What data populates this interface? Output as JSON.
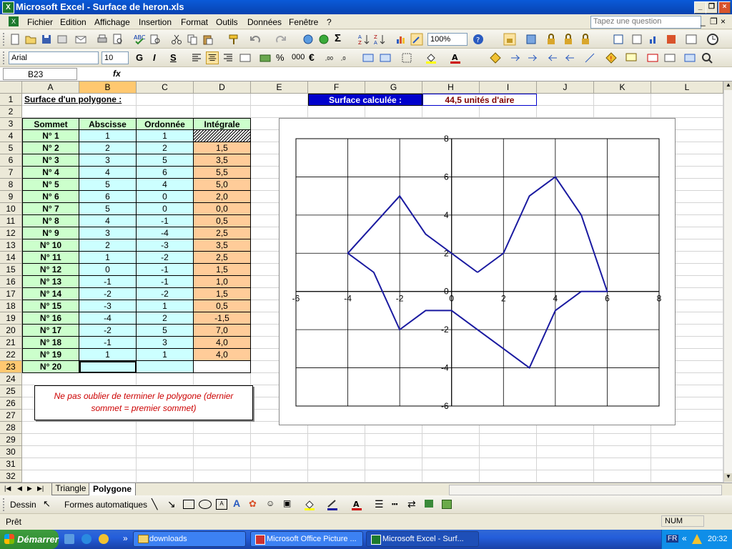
{
  "window": {
    "title": "Microsoft Excel - Surface de heron.xls",
    "app_icon": "excel-icon"
  },
  "menu": {
    "items": [
      "Fichier",
      "Edition",
      "Affichage",
      "Insertion",
      "Format",
      "Outils",
      "Données",
      "Fenêtre",
      "?"
    ],
    "ask_placeholder": "Tapez une question"
  },
  "toolbar": {
    "zoom": "100%",
    "font": "Arial",
    "size": "10",
    "bold": "G",
    "italic": "I",
    "underline": "S",
    "percent": "%",
    "thousands": "000",
    "euro": "€"
  },
  "formula_bar": {
    "name_box": "B23",
    "fx": "fx",
    "content": ""
  },
  "columns": [
    "A",
    "B",
    "C",
    "D",
    "E",
    "F",
    "G",
    "H",
    "I",
    "J",
    "K",
    "L"
  ],
  "rows": [
    "1",
    "2",
    "3",
    "4",
    "5",
    "6",
    "7",
    "8",
    "9",
    "10",
    "11",
    "12",
    "13",
    "14",
    "15",
    "16",
    "17",
    "18",
    "19",
    "20",
    "21",
    "22",
    "23",
    "24",
    "25",
    "26",
    "27",
    "28",
    "29",
    "30",
    "31",
    "32"
  ],
  "sheet": {
    "title": "Surface d'un polygone :",
    "surface_label": "Surface calculée :",
    "surface_value": "44,5 unités d'aire",
    "headers": [
      "Sommet",
      "Abscisse",
      "Ordonnée",
      "Intégrale"
    ],
    "table": [
      [
        "N° 1",
        "1",
        "1",
        ""
      ],
      [
        "N° 2",
        "2",
        "2",
        "1,5"
      ],
      [
        "N° 3",
        "3",
        "5",
        "3,5"
      ],
      [
        "N° 4",
        "4",
        "6",
        "5,5"
      ],
      [
        "N° 5",
        "5",
        "4",
        "5,0"
      ],
      [
        "N° 6",
        "6",
        "0",
        "2,0"
      ],
      [
        "N° 7",
        "5",
        "0",
        "0,0"
      ],
      [
        "N° 8",
        "4",
        "-1",
        "0,5"
      ],
      [
        "N° 9",
        "3",
        "-4",
        "2,5"
      ],
      [
        "N° 10",
        "2",
        "-3",
        "3,5"
      ],
      [
        "N° 11",
        "1",
        "-2",
        "2,5"
      ],
      [
        "N° 12",
        "0",
        "-1",
        "1,5"
      ],
      [
        "N° 13",
        "-1",
        "-1",
        "1,0"
      ],
      [
        "N° 14",
        "-2",
        "-2",
        "1,5"
      ],
      [
        "N° 15",
        "-3",
        "1",
        "0,5"
      ],
      [
        "N° 16",
        "-4",
        "2",
        "-1,5"
      ],
      [
        "N° 17",
        "-2",
        "5",
        "7,0"
      ],
      [
        "N° 18",
        "-1",
        "3",
        "4,0"
      ],
      [
        "N° 19",
        "1",
        "1",
        "4,0"
      ],
      [
        "N° 20",
        "",
        "",
        ""
      ]
    ],
    "note": "Ne pas oublier de terminer le polygone (dernier sommet = premier sommet)",
    "colors": {
      "header": "#ccffcc",
      "sommet": "#ccffcc",
      "coords": "#ccffff",
      "integral": "#ffcc99",
      "surface_label_bg": "#0000cc",
      "surface_value": "#800000",
      "note": "#cc0000"
    }
  },
  "chart_data": {
    "type": "scatter",
    "x": [
      1,
      2,
      3,
      4,
      5,
      6,
      5,
      4,
      3,
      2,
      1,
      0,
      -1,
      -2,
      -3,
      -4,
      -2,
      -1,
      1
    ],
    "y": [
      1,
      2,
      5,
      6,
      4,
      0,
      0,
      -1,
      -4,
      -3,
      -2,
      -1,
      -1,
      -2,
      1,
      2,
      5,
      3,
      1
    ],
    "xlim": [
      -6,
      8
    ],
    "ylim": [
      -6,
      8
    ],
    "xticks": [
      "-6",
      "-4",
      "-2",
      "0",
      "2",
      "4",
      "6",
      "8"
    ],
    "yticks": [
      "-6",
      "-4",
      "-2",
      "0",
      "2",
      "4",
      "6",
      "8"
    ],
    "grid": true,
    "line_color": "#1a1aa0"
  },
  "tabs": {
    "items": [
      "Triangle",
      "Polygone"
    ],
    "active": 1
  },
  "drawing": {
    "menu": "Dessin",
    "autoshapes": "Formes automatiques"
  },
  "status": {
    "left": "Prêt",
    "num": "NUM"
  },
  "taskbar": {
    "start": "Démarrer",
    "tasks": [
      "downloads",
      "Microsoft Office Picture ...",
      "Microsoft Excel - Surf..."
    ],
    "lang": "FR",
    "clock": "20:32"
  }
}
